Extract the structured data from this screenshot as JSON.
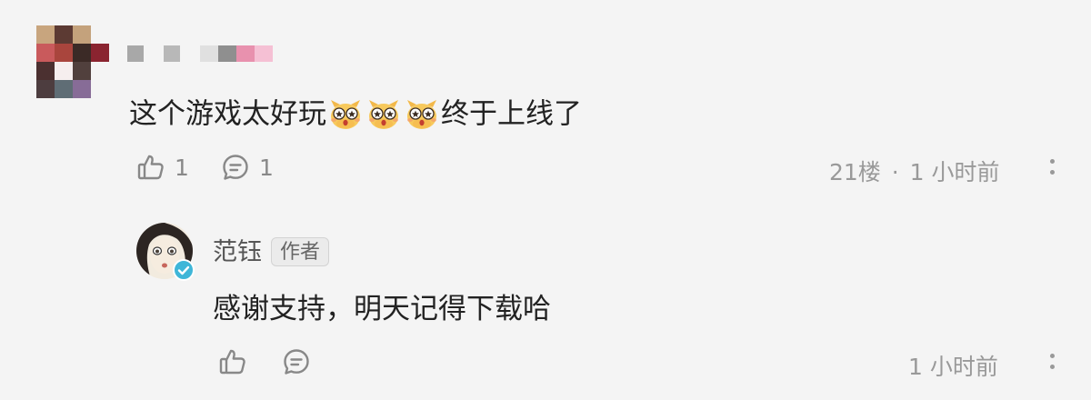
{
  "comment": {
    "text_before": "这个游戏太好玩",
    "emoji_name": "star-eyes-emoji",
    "emoji_count": 3,
    "text_after": "终于上线了",
    "like_count": "1",
    "reply_count": "1",
    "floor": "21楼",
    "separator": "·",
    "time": "1 小时前",
    "avatar_mosaic_colors": [
      [
        "#c8a57e",
        "#5c3a33",
        "#c4a27c",
        "#f4f4f4"
      ],
      [
        "#c95a5c",
        "#a9453d",
        "#3b2a26",
        "#8a2430"
      ],
      [
        "#4b3030",
        "#f6eeee",
        "#51403d",
        "#f4f4f4"
      ],
      [
        "#4d3d3f",
        "#5f6d75",
        "#876c97",
        "#f4f4f4"
      ]
    ],
    "name_mosaic_colors": [
      "#a8a8a8",
      "#b8b8b8",
      "#e0e0e0",
      "#8f8f8f",
      "#e891ae",
      "#f5c0d4"
    ]
  },
  "reply": {
    "author": "范钰",
    "badge": "作者",
    "text": "感谢支持，明天记得下载哈",
    "time": "1 小时前"
  },
  "colors": {
    "background": "#f4f4f4",
    "text": "#222222",
    "muted": "#999999",
    "verified": "#3fb6d8"
  }
}
